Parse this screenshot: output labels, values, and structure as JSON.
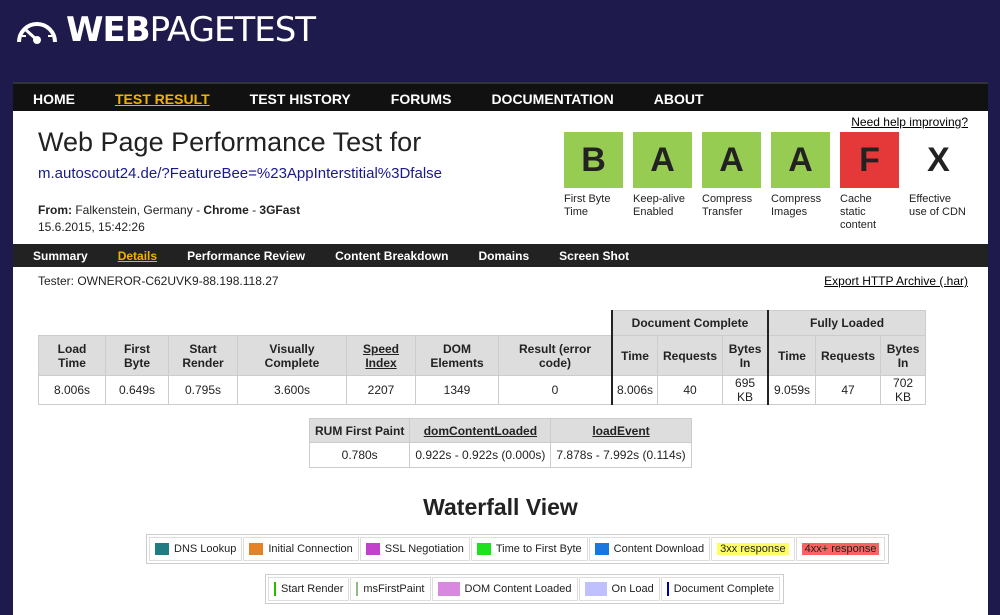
{
  "logo": {
    "bold": "WEB",
    "rest": "PAGETEST"
  },
  "nav": [
    "HOME",
    "TEST RESULT",
    "TEST HISTORY",
    "FORUMS",
    "DOCUMENTATION",
    "ABOUT"
  ],
  "help_link": "Need help improving?",
  "title": "Web Page Performance Test for",
  "url": "m.autoscout24.de/?FeatureBee=%23AppInterstitial%3Dfalse",
  "from_label": "From:",
  "from_location": "Falkenstein, Germany",
  "browser": "Chrome",
  "connection": "3GFast",
  "date": "15.6.2015, 15:42:26",
  "grades": [
    {
      "grade": "B",
      "label": "First Byte Time",
      "color": "#97cc53"
    },
    {
      "grade": "A",
      "label": "Keep-alive Enabled",
      "color": "#97cc53"
    },
    {
      "grade": "A",
      "label": "Compress Transfer",
      "color": "#97cc53"
    },
    {
      "grade": "A",
      "label": "Compress Images",
      "color": "#97cc53"
    },
    {
      "grade": "F",
      "label": "Cache static content",
      "color": "#e53939"
    },
    {
      "grade": "X",
      "label": "Effective use of CDN",
      "color": "#ffffff"
    }
  ],
  "subnav": [
    "Summary",
    "Details",
    "Performance Review",
    "Content Breakdown",
    "Domains",
    "Screen Shot"
  ],
  "tester": "Tester: OWNEROR-C62UVK9-88.198.118.27",
  "export": "Export HTTP Archive (.har)",
  "results": {
    "group_doc": "Document Complete",
    "group_full": "Fully Loaded",
    "headers": [
      "Load Time",
      "First Byte",
      "Start Render",
      "Visually Complete",
      "Speed Index",
      "DOM Elements",
      "Result (error code)"
    ],
    "sub_headers": {
      "time": "Time",
      "requests": "Requests",
      "bytes": "Bytes In"
    },
    "values": [
      "8.006s",
      "0.649s",
      "0.795s",
      "3.600s",
      "2207",
      "1349",
      "0"
    ],
    "doc": [
      "8.006s",
      "40",
      "695 KB"
    ],
    "full": [
      "9.059s",
      "47",
      "702 KB"
    ]
  },
  "rum": {
    "headers": [
      "RUM First Paint",
      "domContentLoaded",
      "loadEvent"
    ],
    "values": [
      "0.780s",
      "0.922s - 0.922s (0.000s)",
      "7.878s - 7.992s (0.114s)"
    ]
  },
  "waterfall_title": "Waterfall View",
  "legend1": [
    {
      "label": "DNS Lookup",
      "color": "#1f7c83"
    },
    {
      "label": "Initial Connection",
      "color": "#e58226"
    },
    {
      "label": "SSL Negotiation",
      "color": "#c141cd"
    },
    {
      "label": "Time to First Byte",
      "color": "#1fe11f"
    },
    {
      "label": "Content Download",
      "color": "#1977dd"
    },
    {
      "label": "3xx response",
      "color": "#ffff60"
    },
    {
      "label": "4xx+ response",
      "color": "#ff6060"
    }
  ],
  "legend2": [
    {
      "label": "Start Render",
      "color": "#28bc00"
    },
    {
      "label": "msFirstPaint",
      "color": "#8fbc83"
    },
    {
      "label": "DOM Content Loaded",
      "color": "#d888df"
    },
    {
      "label": "On Load",
      "color": "#c0c0ff"
    },
    {
      "label": "Document Complete",
      "color": "#0000aa"
    }
  ]
}
